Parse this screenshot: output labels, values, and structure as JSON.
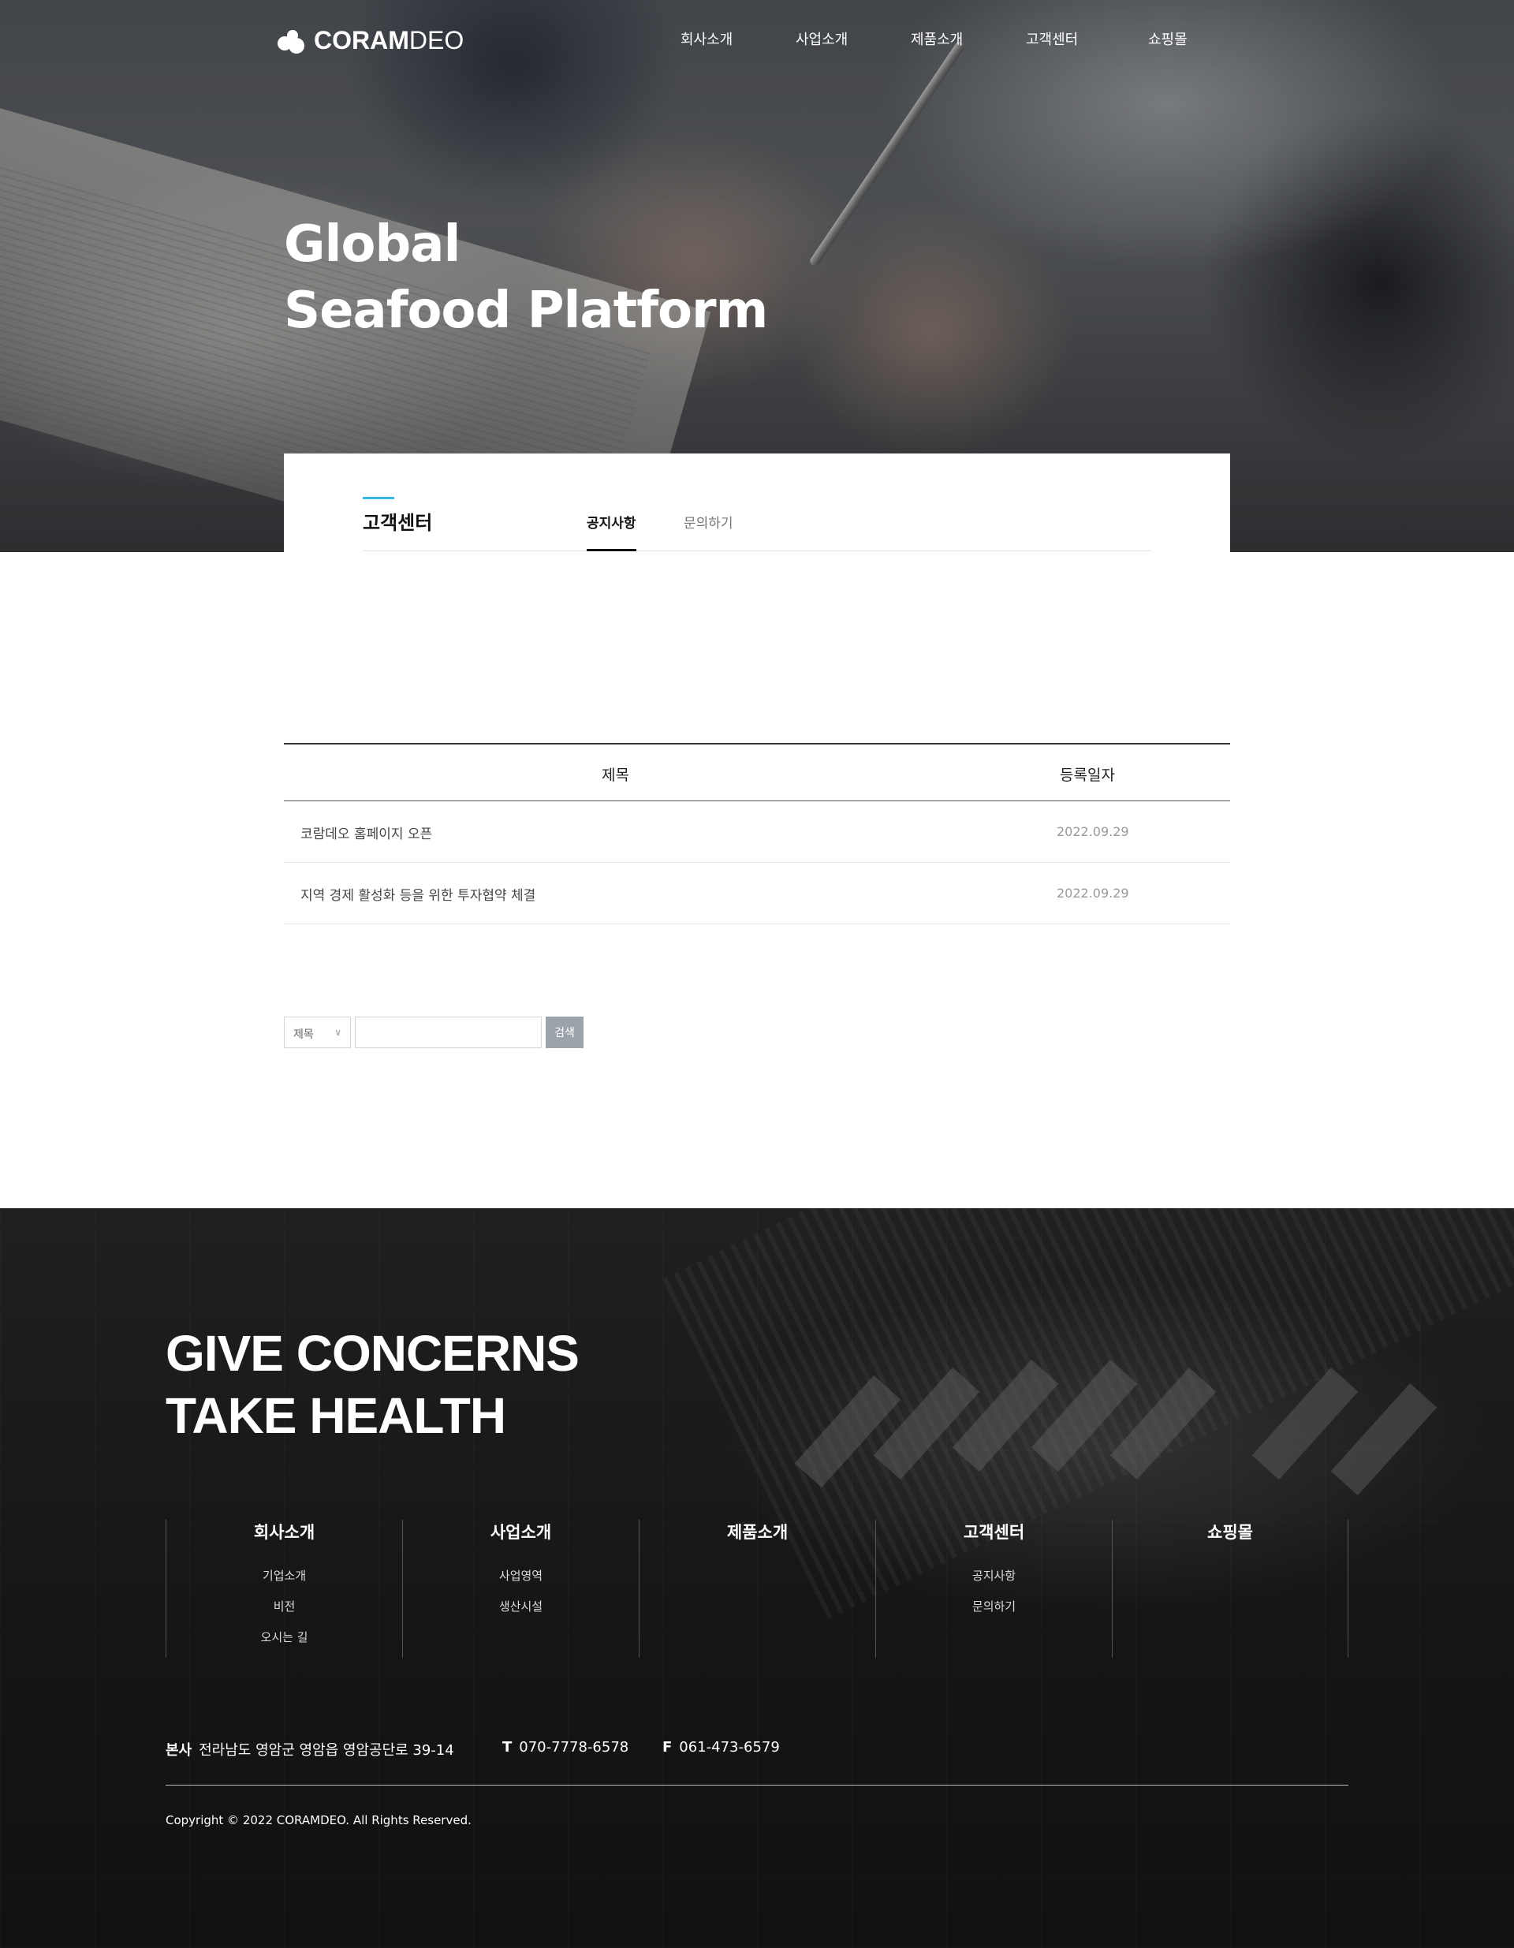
{
  "brand": {
    "name_bold": "CORAM",
    "name_light": "DEO"
  },
  "nav": [
    "회사소개",
    "사업소개",
    "제품소개",
    "고객센터",
    "쇼핑몰"
  ],
  "hero": {
    "title_line1": "Global",
    "title_line2": "Seafood Platform"
  },
  "subnav": {
    "title": "고객센터",
    "tabs": [
      {
        "label": "공지사항",
        "active": true
      },
      {
        "label": "문의하기",
        "active": false
      }
    ]
  },
  "board": {
    "headers": {
      "title": "제목",
      "date": "등록일자"
    },
    "rows": [
      {
        "title": "코람데오 홈페이지 오픈",
        "date": "2022.09.29"
      },
      {
        "title": "지역 경제 활성화 등을 위한 투자협약 체결",
        "date": "2022.09.29"
      }
    ]
  },
  "search": {
    "field_selected": "제목",
    "input_value": "",
    "button_label": "검색"
  },
  "footer": {
    "slogan_line1": "GIVE CONCERNS",
    "slogan_line2": "TAKE HEALTH",
    "columns": [
      {
        "title": "회사소개",
        "links": [
          "기업소개",
          "비전",
          "오시는 길"
        ]
      },
      {
        "title": "사업소개",
        "links": [
          "사업영역",
          "생산시설"
        ]
      },
      {
        "title": "제품소개",
        "links": []
      },
      {
        "title": "고객센터",
        "links": [
          "공지사항",
          "문의하기"
        ]
      },
      {
        "title": "쇼핑몰",
        "links": []
      }
    ],
    "contact": {
      "address_label": "본사",
      "address": "전라남도 영암군 영암읍 영암공단로 39-14",
      "tel_label": "T",
      "tel": "070-7778-6578",
      "fax_label": "F",
      "fax": "061-473-6579"
    },
    "copyright": "Copyright © 2022 CORAMDEO. All Rights Reserved."
  },
  "colors": {
    "accent": "#37b6e8",
    "search_button": "#9da3ab",
    "footer_bg": "#1a1a1a"
  }
}
